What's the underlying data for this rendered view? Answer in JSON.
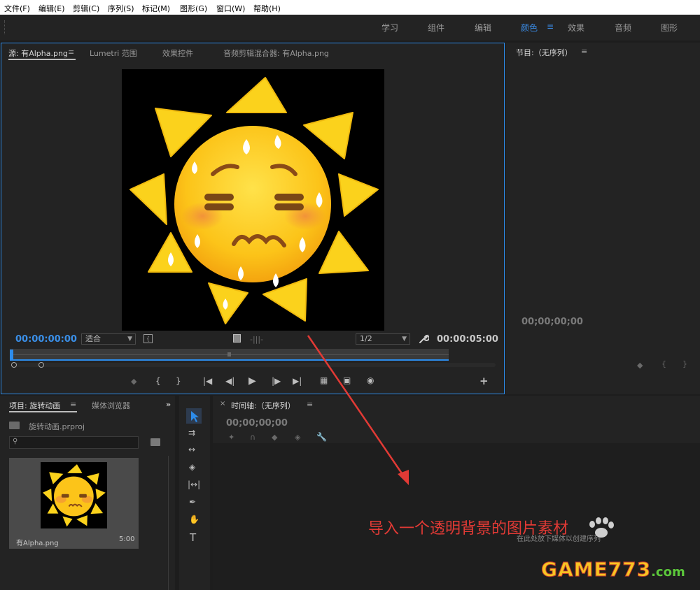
{
  "menubar": [
    "文件(F)",
    "编辑(E)",
    "剪辑(C)",
    "序列(S)",
    "标记(M)",
    "图形(G)",
    "窗口(W)",
    "帮助(H)"
  ],
  "workspaces": {
    "items": [
      "学习",
      "组件",
      "编辑",
      "颜色",
      "效果",
      "音频",
      "图形"
    ],
    "active": "颜色"
  },
  "source_panel": {
    "tabs": [
      "源: 有Alpha.png",
      "Lumetri 范围",
      "效果控件",
      "音频剪辑混合器: 有Alpha.png"
    ],
    "timecode_in": "00:00:00:00",
    "fit_label": "适合",
    "resolution": "1/2",
    "timecode_out": "00:00:05:00"
  },
  "program_panel": {
    "title": "节目:（无序列）",
    "timecode": "00;00;00;00"
  },
  "project_panel": {
    "tabs": [
      "项目: 旋转动画",
      "媒体浏览器"
    ],
    "file_name": "旋转动画.prproj",
    "search_placeholder": "",
    "clip_name": "有Alpha.png",
    "clip_duration": "5:00"
  },
  "timeline_panel": {
    "title": "时间轴:（无序列）",
    "timecode": "00;00;00;00",
    "close_glyph": "×"
  },
  "overlay": {
    "annotation_text": "导入一个透明背景的图片素材",
    "hint_text": "在此处放下媒体以创建序列",
    "watermark_game": "GAME773",
    "watermark_com": ".com",
    "annotation_color": "#e23a35"
  },
  "icons": {
    "menu": "≡",
    "more": "»",
    "wrench": "🔧",
    "plus": "+",
    "play": "▶"
  }
}
